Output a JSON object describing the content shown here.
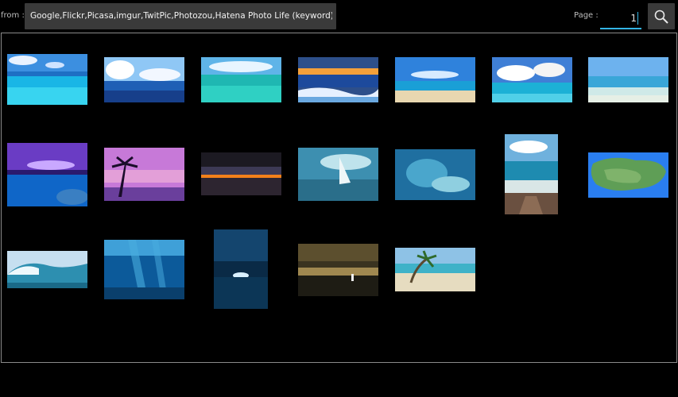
{
  "toolbar": {
    "from_label": "from :",
    "source_value": "Google,Flickr,Picasa,imgur,TwitPic,Photozou,Hatena Photo Life (keyword),Hatena",
    "page_label": "Page :",
    "page_value": "1",
    "search_icon": "search-icon"
  },
  "colors": {
    "background": "#000000",
    "field_bg": "#3a3a3a",
    "accent": "#33b5e5",
    "panel_border": "#8a8a8a"
  },
  "thumbnails": [
    {
      "id": 1,
      "scene": "tropical-lagoon-clouds"
    },
    {
      "id": 2,
      "scene": "ocean-sunlight-clouds"
    },
    {
      "id": 3,
      "scene": "turquoise-reef-water"
    },
    {
      "id": 4,
      "scene": "wave-sunset-shore"
    },
    {
      "id": 5,
      "scene": "beach-blue-sky"
    },
    {
      "id": 6,
      "scene": "sea-cumulus-clouds"
    },
    {
      "id": 7,
      "scene": "calm-sea-horizon"
    },
    {
      "id": 8,
      "scene": "purple-night-sea"
    },
    {
      "id": 9,
      "scene": "palm-tree-pink-sunset"
    },
    {
      "id": 10,
      "scene": "orange-sunset-horizon"
    },
    {
      "id": 11,
      "scene": "sailboat-ocean-art"
    },
    {
      "id": 12,
      "scene": "mermaid-underwater-art"
    },
    {
      "id": 13,
      "scene": "wooden-stairs-to-sea"
    },
    {
      "id": 14,
      "scene": "island-map"
    },
    {
      "id": 15,
      "scene": "big-wave-surf"
    },
    {
      "id": 16,
      "scene": "underwater-light-rays"
    },
    {
      "id": 17,
      "scene": "dark-blue-horizon-light"
    },
    {
      "id": 18,
      "scene": "stormy-shore-figure"
    },
    {
      "id": 19,
      "scene": "palm-beach-shore"
    }
  ]
}
